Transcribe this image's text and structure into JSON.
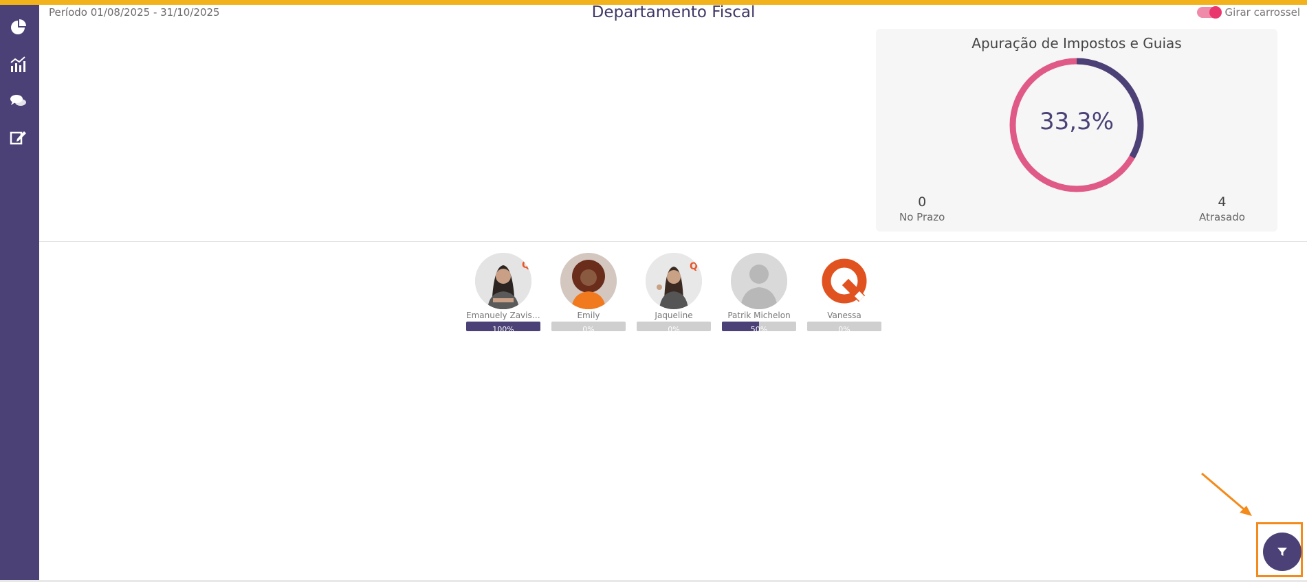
{
  "header": {
    "period": "Período 01/08/2025 - 31/10/2025",
    "title": "Departamento Fiscal",
    "carousel_toggle_label": "Girar carrossel"
  },
  "sidebar": {
    "icons": [
      "pie-chart-icon",
      "chart-bar-line-icon",
      "chat-bubbles-icon",
      "edit-icon"
    ]
  },
  "card": {
    "title": "Apuração de Impostos e Guias",
    "percent": "33,3%",
    "on_time": {
      "value": "0",
      "label": "No Prazo"
    },
    "late": {
      "value": "4",
      "label": "Atrasado"
    },
    "colors": {
      "completed": "#4b4176",
      "late": "#e05a87"
    },
    "fraction": 0.333
  },
  "team": [
    {
      "name": "Emanuely Zavist...",
      "progress_label": "100%",
      "progress": 1.0
    },
    {
      "name": "Emily",
      "progress_label": "0%",
      "progress": 0.0
    },
    {
      "name": "Jaqueline",
      "progress_label": "0%",
      "progress": 0.0
    },
    {
      "name": "Patrik Michelon",
      "progress_label": "50%",
      "progress": 0.5
    },
    {
      "name": "Vanessa",
      "progress_label": "0%",
      "progress": 0.0
    }
  ],
  "fab": {
    "icon": "filter-icon"
  },
  "colors": {
    "accent": "#4b4176",
    "topbar": "#f2b21c",
    "highlight": "#f48a1a"
  }
}
